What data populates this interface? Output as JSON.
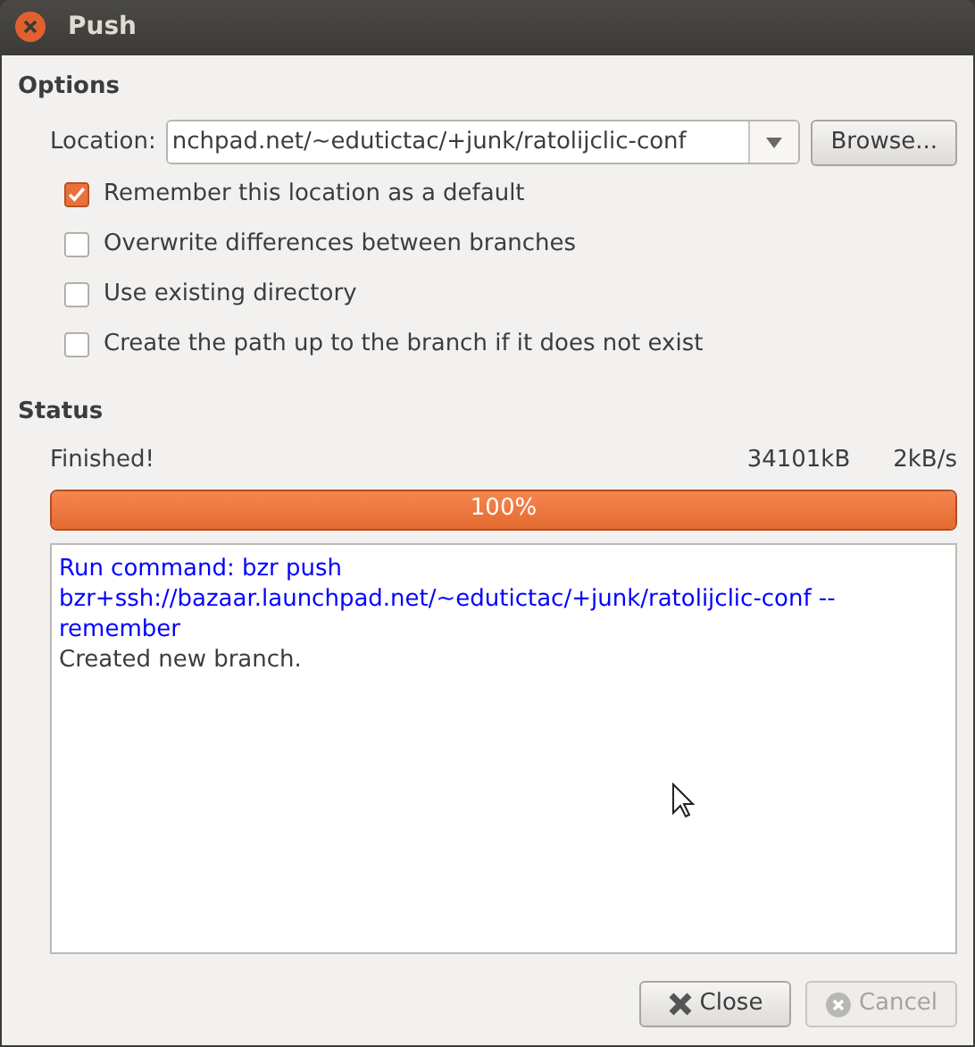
{
  "window": {
    "title": "Push"
  },
  "options": {
    "heading": "Options",
    "location": {
      "label": "Location:",
      "value": "nchpad.net/~edutictac/+junk/ratolijclic-conf"
    },
    "browse_button": "Browse...",
    "checkboxes": [
      {
        "label": "Remember this location as a default",
        "checked": true
      },
      {
        "label": "Overwrite differences between branches",
        "checked": false
      },
      {
        "label": "Use existing directory",
        "checked": false
      },
      {
        "label": "Create the path up to the branch if it does not exist",
        "checked": false
      }
    ]
  },
  "status": {
    "heading": "Status",
    "message": "Finished!",
    "size": "34101kB",
    "rate": "2kB/s",
    "progress": {
      "level": 1,
      "text": "100%"
    },
    "log": [
      {
        "kind": "command",
        "text": "Run command: bzr push bzr+ssh://bazaar.launchpad.net/~edutictac/+junk/ratolijclic-conf --remember"
      },
      {
        "kind": "output",
        "text": "Created new branch."
      }
    ]
  },
  "buttons": [
    {
      "label": "Close",
      "disabled": false
    },
    {
      "label": "Cancel",
      "disabled": true
    }
  ]
}
